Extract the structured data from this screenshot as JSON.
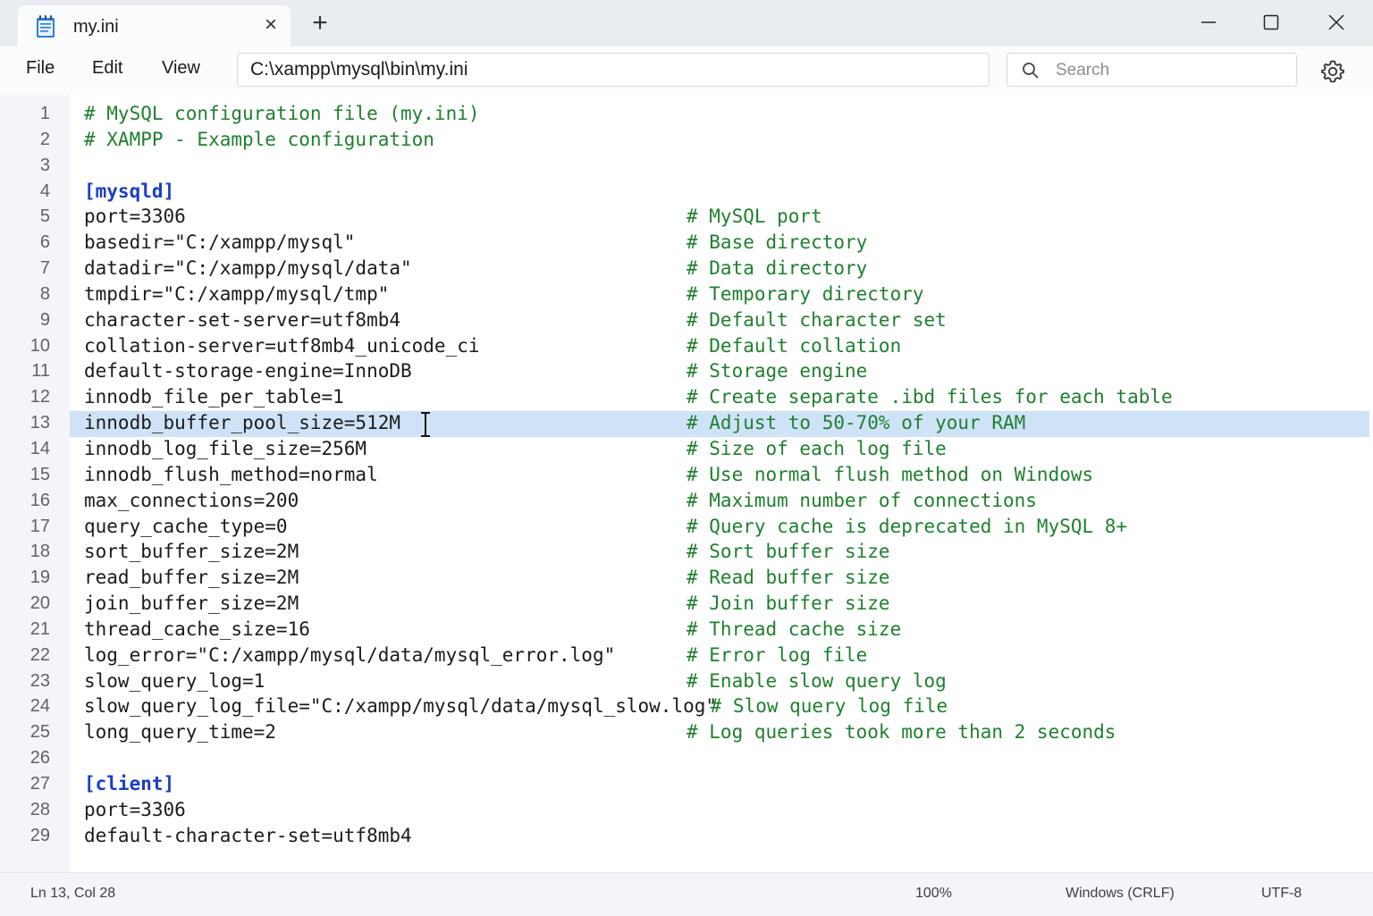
{
  "window": {
    "tab_title": "my.ini",
    "new_tab_label": "+",
    "close_tab_label": "×"
  },
  "menu": {
    "file": "File",
    "edit": "Edit",
    "view": "View"
  },
  "path": "C:\\xampp\\mysql\\bin\\my.ini",
  "search": {
    "placeholder": "Search"
  },
  "editor": {
    "active_line": 13,
    "lines": [
      {
        "n": "1",
        "code": "# MySQL configuration file (my.ini)",
        "comment": "",
        "kind": "comment"
      },
      {
        "n": "2",
        "code": "# XAMPP - Example configuration",
        "comment": "",
        "kind": "comment"
      },
      {
        "n": "3",
        "code": "",
        "comment": "",
        "kind": "plain"
      },
      {
        "n": "4",
        "code": "[mysqld]",
        "comment": "",
        "kind": "section"
      },
      {
        "n": "5",
        "code": "port=3306",
        "comment": "# MySQL port",
        "kind": "plain"
      },
      {
        "n": "6",
        "code": "basedir=\"C:/xampp/mysql\"",
        "comment": "# Base directory",
        "kind": "plain"
      },
      {
        "n": "7",
        "code": "datadir=\"C:/xampp/mysql/data\"",
        "comment": "# Data directory",
        "kind": "plain"
      },
      {
        "n": "8",
        "code": "tmpdir=\"C:/xampp/mysql/tmp\"",
        "comment": "# Temporary directory",
        "kind": "plain"
      },
      {
        "n": "9",
        "code": "character-set-server=utf8mb4",
        "comment": "# Default character set",
        "kind": "plain"
      },
      {
        "n": "10",
        "code": "collation-server=utf8mb4_unicode_ci",
        "comment": "# Default collation",
        "kind": "plain"
      },
      {
        "n": "11",
        "code": "default-storage-engine=InnoDB",
        "comment": "# Storage engine",
        "kind": "plain"
      },
      {
        "n": "12",
        "code": "innodb_file_per_table=1",
        "comment": "# Create separate .ibd files for each table",
        "kind": "plain"
      },
      {
        "n": "13",
        "code": "innodb_buffer_pool_size=512M",
        "comment": "# Adjust to 50-70% of your RAM",
        "kind": "plain"
      },
      {
        "n": "14",
        "code": "innodb_log_file_size=256M",
        "comment": "# Size of each log file",
        "kind": "plain"
      },
      {
        "n": "15",
        "code": "innodb_flush_method=normal",
        "comment": "# Use normal flush method on Windows",
        "kind": "plain"
      },
      {
        "n": "16",
        "code": "max_connections=200",
        "comment": "# Maximum number of connections",
        "kind": "plain"
      },
      {
        "n": "17",
        "code": "query_cache_type=0",
        "comment": "# Query cache is deprecated in MySQL 8+",
        "kind": "plain"
      },
      {
        "n": "18",
        "code": "sort_buffer_size=2M",
        "comment": "# Sort buffer size",
        "kind": "plain"
      },
      {
        "n": "19",
        "code": "read_buffer_size=2M",
        "comment": "# Read buffer size",
        "kind": "plain"
      },
      {
        "n": "20",
        "code": "join_buffer_size=2M",
        "comment": "# Join buffer size",
        "kind": "plain"
      },
      {
        "n": "21",
        "code": "thread_cache_size=16",
        "comment": "# Thread cache size",
        "kind": "plain"
      },
      {
        "n": "22",
        "code": "log_error=\"C:/xampp/mysql/data/mysql_error.log\"",
        "comment": "# Error log file",
        "kind": "plain"
      },
      {
        "n": "23",
        "code": "slow_query_log=1",
        "comment": "# Enable slow query log",
        "kind": "plain"
      },
      {
        "n": "24",
        "code": "slow_query_log_file=\"C:/xampp/mysql/data/mysql_slow.log\"",
        "comment": " # Slow query log file",
        "kind": "inline"
      },
      {
        "n": "25",
        "code": "long_query_time=2",
        "comment": "# Log queries took more than 2 seconds",
        "kind": "plain"
      },
      {
        "n": "26",
        "code": "",
        "comment": "",
        "kind": "plain"
      },
      {
        "n": "27",
        "code": "[client]",
        "comment": "",
        "kind": "section"
      },
      {
        "n": "28",
        "code": "port=3306",
        "comment": "",
        "kind": "plain"
      },
      {
        "n": "29",
        "code": "default-character-set=utf8mb4",
        "comment": "",
        "kind": "plain"
      }
    ]
  },
  "status": {
    "position": "Ln 13, Col 28",
    "zoom": "100%",
    "line_ending": "Windows (CRLF)",
    "encoding": "UTF-8"
  },
  "colors": {
    "comment": "#1f7f2e",
    "section": "#1a3ec4",
    "active_line": "#cfe3f8"
  },
  "icons": {
    "tab": "notepad-icon",
    "search": "search-icon",
    "settings": "gear-icon",
    "minimize": "minimize-icon",
    "maximize": "maximize-icon",
    "close": "close-icon"
  }
}
